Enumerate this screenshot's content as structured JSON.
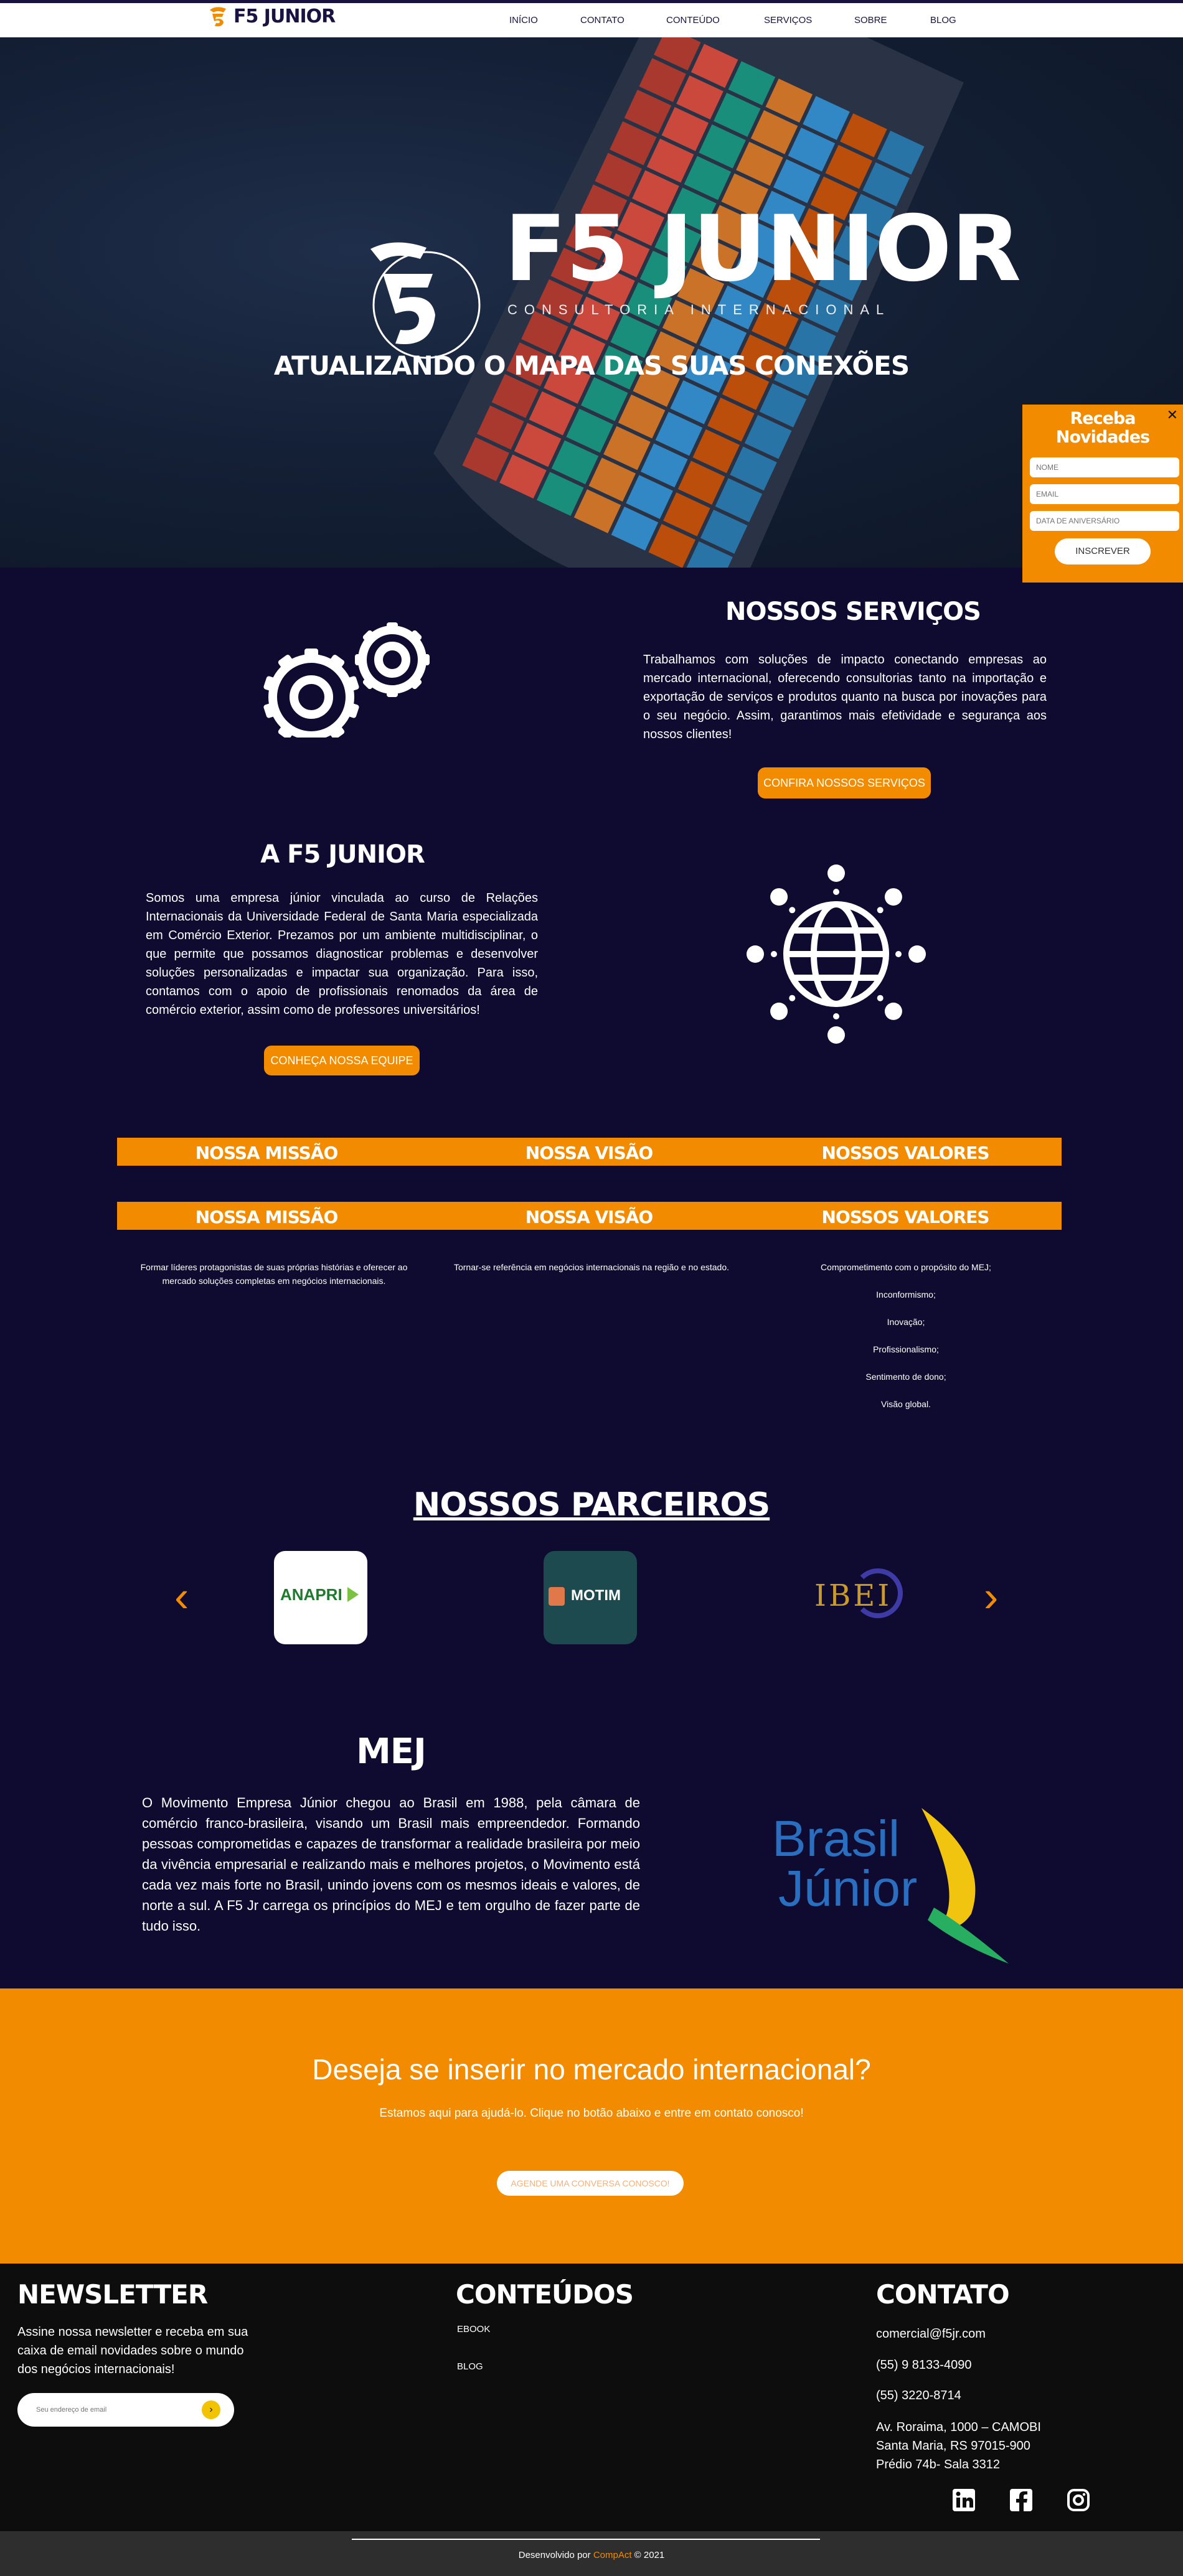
{
  "brand": {
    "name": "F5 JUNIOR"
  },
  "nav": {
    "items": [
      "INÍCIO",
      "CONTATO",
      "CONTEÚDO",
      "SERVIÇOS",
      "SOBRE",
      "BLOG"
    ]
  },
  "hero": {
    "title": "F5 JUNIOR",
    "subtitle": "CONSULTORIA INTERNACIONAL",
    "tagline": "ATUALIZANDO O MAPA DAS SUAS CONEXÕES"
  },
  "popup": {
    "title": "Receba Novidades",
    "close": "✕",
    "name_placeholder": "NOME",
    "email_placeholder": "EMAIL",
    "birthday_placeholder": "DATA DE ANIVERSÁRIO",
    "submit": "INSCREVER"
  },
  "services": {
    "title": "NOSSOS SERVIÇOS",
    "text": "Trabalhamos com soluções de impacto conectando empresas ao mercado internacional, oferecendo consultorias tanto na importação e exportação de serviços e produtos quanto na busca por inovações para o seu negócio. Assim, garantimos mais efetividade e segurança aos nossos clientes!",
    "button": "CONFIRA NOSSOS SERVIÇOS"
  },
  "about": {
    "title": "A F5 JUNIOR",
    "text": "Somos uma empresa júnior vinculada ao curso de Relações Internacionais da Universidade Federal de Santa Maria especializada em Comércio Exterior. Prezamos por um ambiente multidisciplinar, o que permite que possamos diagnosticar problemas e desenvolver soluções personalizadas e impactar sua organização. Para isso, contamos com o apoio de profissionais renomados da área de comércio exterior, assim como de professores universitários!",
    "button": "CONHEÇA NOSSA EQUIPE"
  },
  "mvv": {
    "labels": [
      "NOSSA MISSÃO",
      "NOSSA VISÃO",
      "NOSSOS VALORES"
    ],
    "mission": "Formar líderes protagonistas de suas próprias histórias e oferecer ao mercado soluções completas em negócios internacionais.",
    "vision": "Tornar-se referência em negócios internacionais na região e no estado.",
    "values": [
      "Comprometimento com o propósito do MEJ;",
      "Inconformismo;",
      "Inovação;",
      "Profissionalismo;",
      "Sentimento de dono;",
      "Visão global."
    ]
  },
  "partners": {
    "title": "NOSSOS PARCEIROS",
    "items": [
      "ANAPRI",
      "MOTIM",
      "IBEI"
    ],
    "prev": "‹",
    "next": "›"
  },
  "mej": {
    "title": "MEJ",
    "text": "O Movimento Empresa Júnior chegou ao Brasil em 1988, pela câmara de comércio franco-brasileira, visando um Brasil mais empreendedor. Formando pessoas comprometidas e capazes de transformar a realidade brasileira por meio da vivência empresarial e realizando mais e melhores projetos, o Movimento está cada vez mais forte no Brasil, unindo jovens com os mesmos ideais e valores, de norte a sul. A F5 Jr carrega os princípios do MEJ e tem orgulho de fazer parte de tudo isso.",
    "logo_line1": "Brasil",
    "logo_line2": "Júnior"
  },
  "cta": {
    "title": "Deseja se inserir no mercado internacional?",
    "text": "Estamos aqui para ajudá-lo. Clique no botão abaixo e entre em contato conosco!",
    "button": "AGENDE UMA CONVERSA CONOSCO!"
  },
  "footer": {
    "newsletter_title": "NEWSLETTER",
    "newsletter_text": "Assine nossa newsletter e receba em sua caixa de email novidades sobre o mundo dos negócios internacionais!",
    "email_placeholder": "Seu endereço de email",
    "content_title": "CONTEÚDOS",
    "content_links": [
      "EBOOK",
      "BLOG"
    ],
    "contact_title": "CONTATO",
    "email": "comercial@f5jr.com",
    "phone1": "(55) 9 8133-4090",
    "phone2": "(55) 3220-8714",
    "address": [
      "Av. Roraima, 1000 – CAMOBI",
      "Santa Maria, RS 97015-900",
      "Prédio 74b- Sala 3312"
    ],
    "social": [
      "linkedin-icon",
      "facebook-icon",
      "instagram-icon"
    ]
  },
  "credits": {
    "prefix": "Desenvolvido por ",
    "brand": "CompAct",
    "suffix": " © 2021"
  },
  "colors": {
    "navy": "#0f0a30",
    "orange": "#f28b00",
    "footer": "#0d0d0d"
  }
}
